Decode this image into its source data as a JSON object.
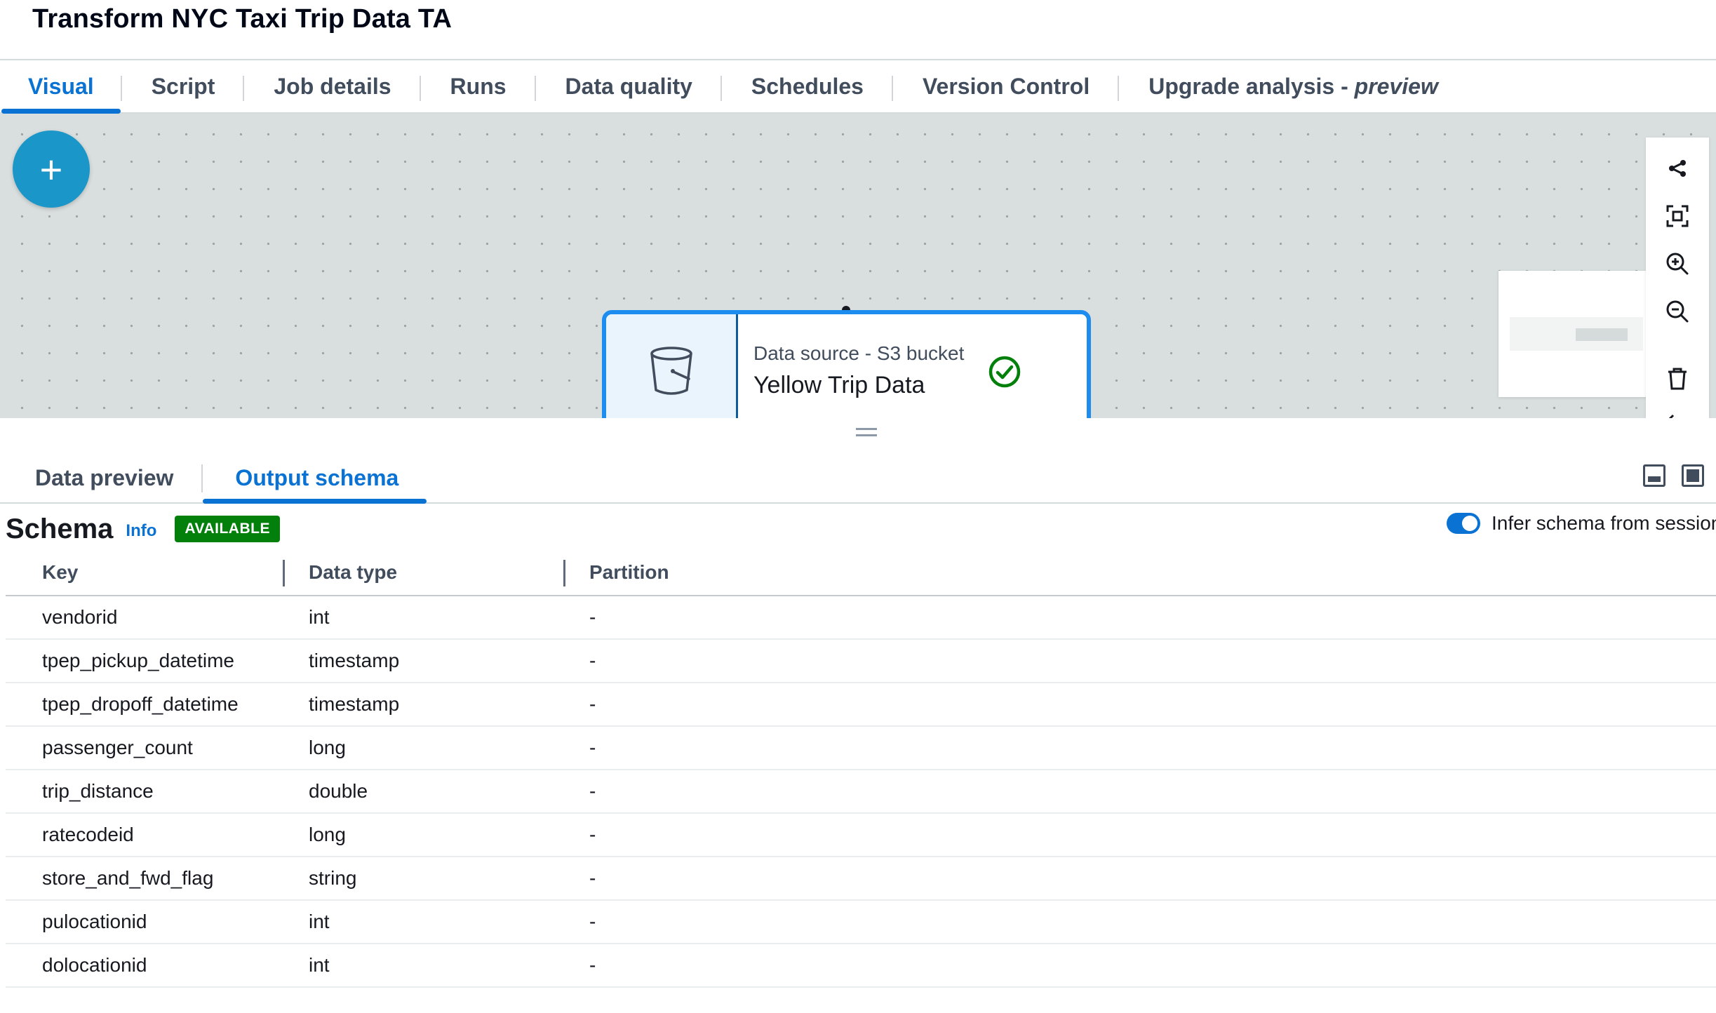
{
  "page": {
    "title": "Transform NYC Taxi Trip Data TA"
  },
  "top_tabs": [
    {
      "label": "Visual",
      "active": true
    },
    {
      "label": "Script"
    },
    {
      "label": "Job details"
    },
    {
      "label": "Runs"
    },
    {
      "label": "Data quality"
    },
    {
      "label": "Schedules"
    },
    {
      "label": "Version Control"
    },
    {
      "label": "Upgrade analysis - ",
      "label_em": "preview"
    }
  ],
  "canvas": {
    "add_label": "+",
    "node": {
      "type": "Data source - S3 bucket",
      "name": "Yellow Trip Data",
      "status": "success",
      "icon": "bucket-icon"
    },
    "toolbar": [
      "share-icon",
      "fit-view-icon",
      "zoom-in-icon",
      "zoom-out-icon",
      "trash-icon",
      "undo-icon"
    ]
  },
  "panel": {
    "tabs": [
      {
        "label": "Data preview"
      },
      {
        "label": "Output schema",
        "active": true
      }
    ],
    "schema": {
      "title": "Schema",
      "info_label": "Info",
      "badge": "AVAILABLE",
      "toggle_label": "Infer schema from session",
      "toggle_on": true
    },
    "table": {
      "columns": [
        "Key",
        "Data type",
        "Partition"
      ],
      "rows": [
        [
          "vendorid",
          "int",
          "-"
        ],
        [
          "tpep_pickup_datetime",
          "timestamp",
          "-"
        ],
        [
          "tpep_dropoff_datetime",
          "timestamp",
          "-"
        ],
        [
          "passenger_count",
          "long",
          "-"
        ],
        [
          "trip_distance",
          "double",
          "-"
        ],
        [
          "ratecodeid",
          "long",
          "-"
        ],
        [
          "store_and_fwd_flag",
          "string",
          "-"
        ],
        [
          "pulocationid",
          "int",
          "-"
        ],
        [
          "dolocationid",
          "int",
          "-"
        ]
      ]
    }
  },
  "colors": {
    "accent": "#0972d3",
    "node_border": "#1d8cef",
    "add_button": "#1a97c8",
    "success": "#037f0c",
    "canvas_bg": "#d9dede"
  }
}
